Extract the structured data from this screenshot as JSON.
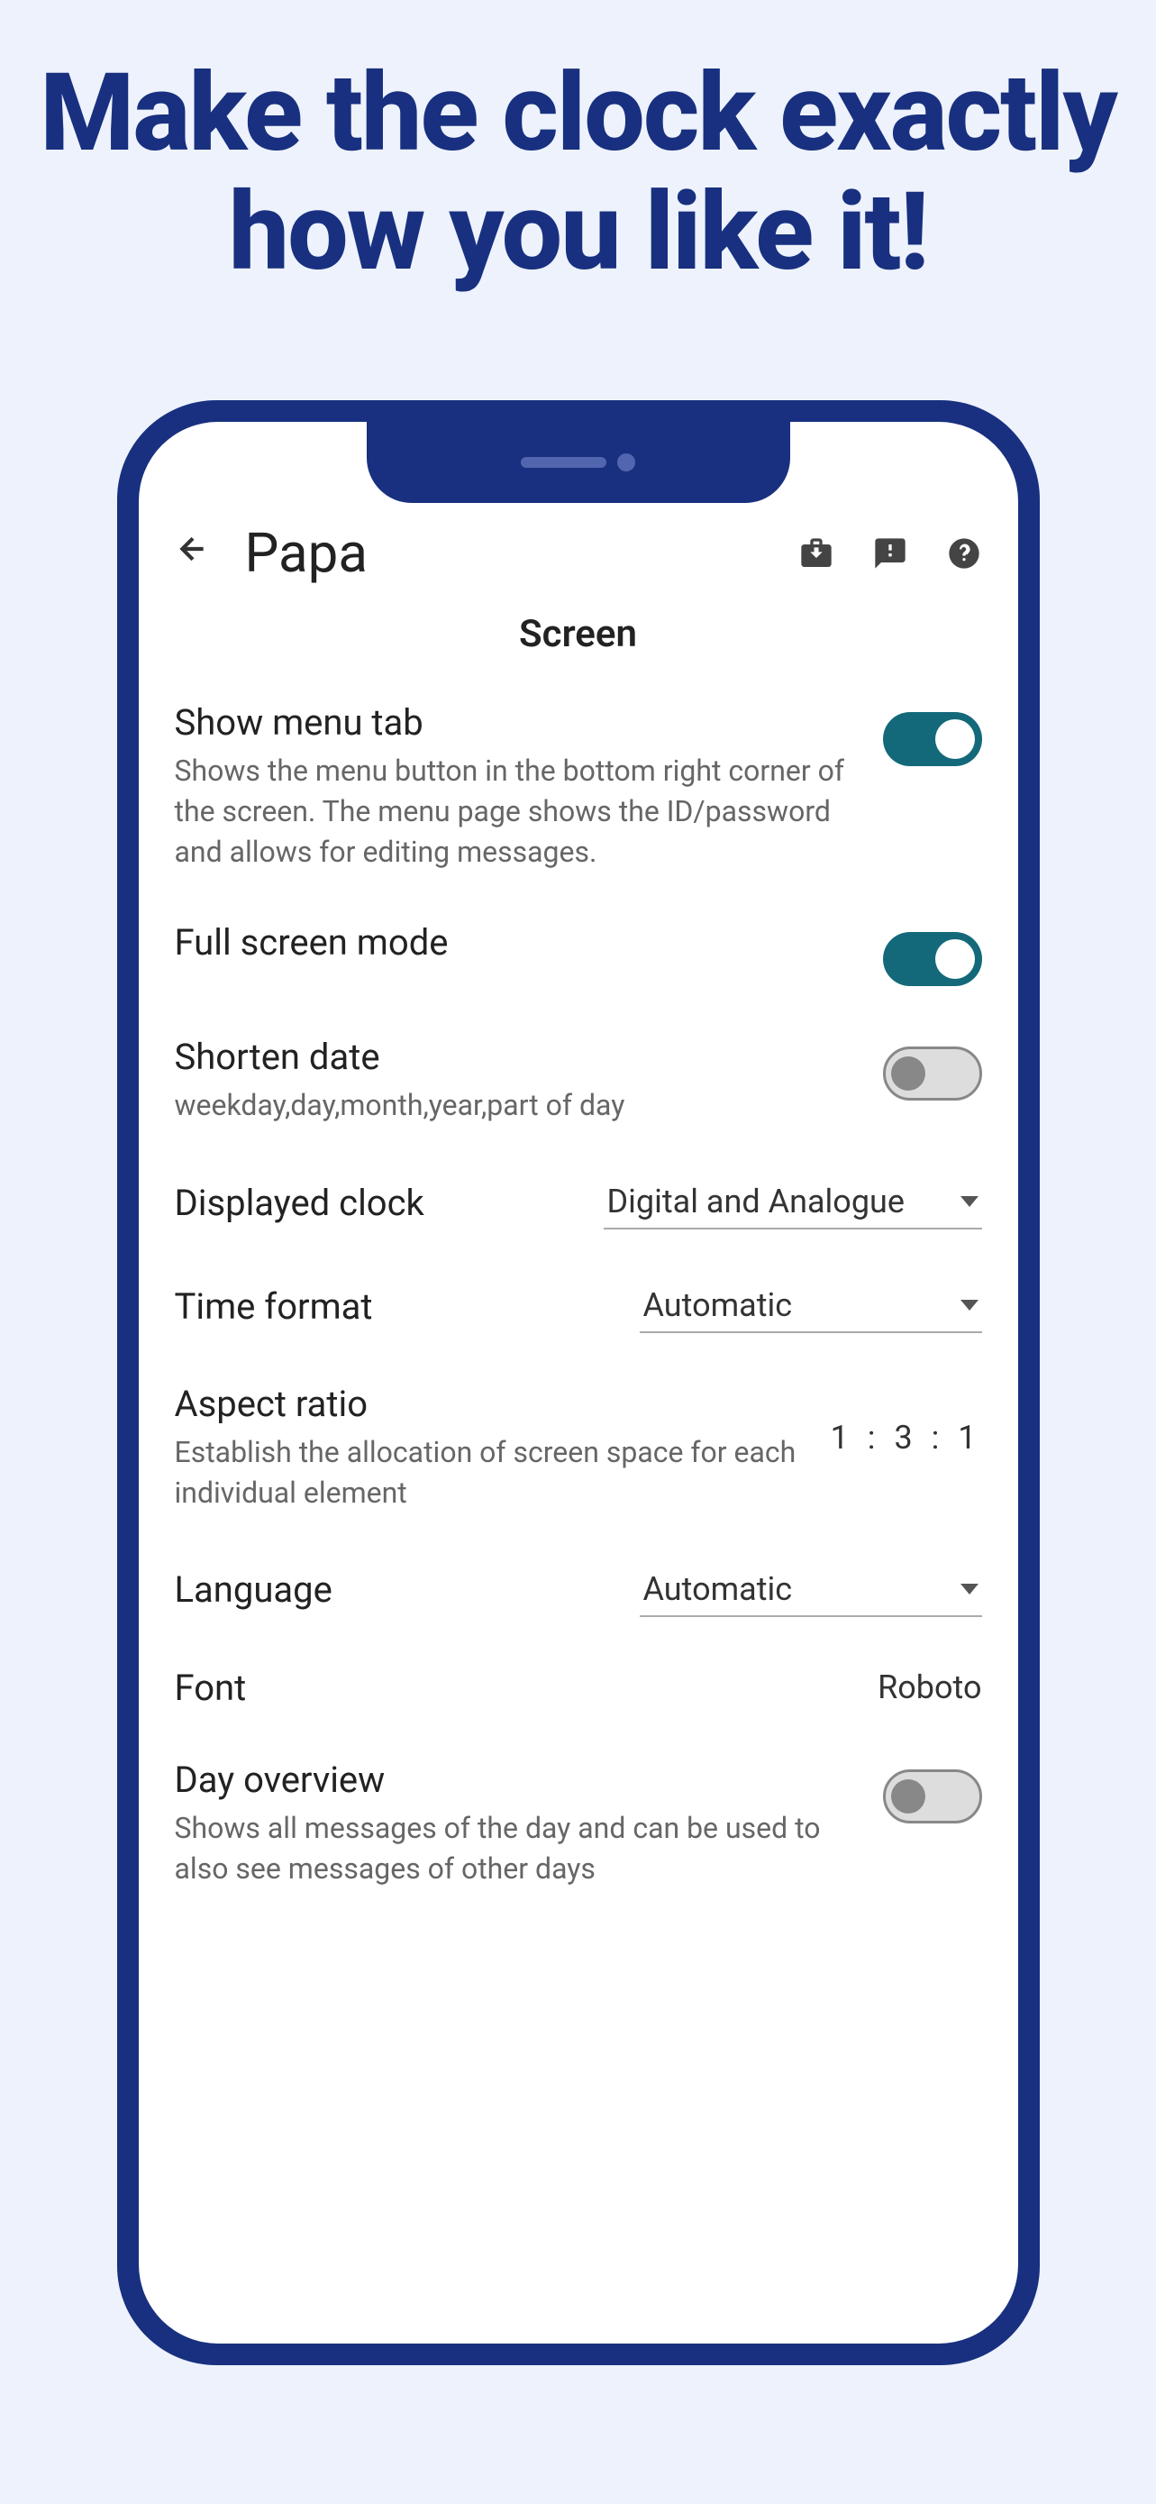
{
  "headline": "Make the clock exactly how you like it!",
  "header": {
    "title": "Papa"
  },
  "section": "Screen",
  "settings": {
    "showMenu": {
      "label": "Show menu tab",
      "desc": "Shows the menu button in the bottom right corner of the screen. The menu page shows the ID/password and allows for editing messages."
    },
    "fullscreen": {
      "label": "Full screen mode"
    },
    "shortenDate": {
      "label": "Shorten date",
      "desc": "weekday,day,month,year,part of day"
    },
    "displayedClock": {
      "label": "Displayed clock",
      "value": "Digital and Analogue"
    },
    "timeFormat": {
      "label": "Time format",
      "value": "Automatic"
    },
    "aspectRatio": {
      "label": "Aspect ratio",
      "desc": "Establish the allocation of screen space for each individual element",
      "value": "1 : 3 : 1"
    },
    "language": {
      "label": "Language",
      "value": "Automatic"
    },
    "font": {
      "label": "Font",
      "value": "Roboto"
    },
    "dayOverview": {
      "label": "Day overview",
      "desc": "Shows all messages of the day and can be used to also see messages of other days"
    }
  }
}
